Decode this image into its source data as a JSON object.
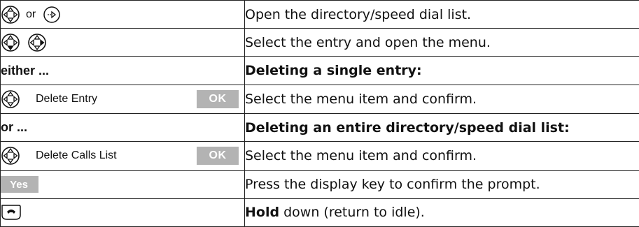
{
  "rows": [
    {
      "type": "step",
      "left": {
        "icons": [
          "control-key-icon",
          "menu-key-icon"
        ],
        "separator": "or"
      },
      "right": "Open the directory/speed dial list."
    },
    {
      "type": "step",
      "left": {
        "icons": [
          "control-key-down-icon",
          "control-key-right-icon"
        ]
      },
      "right": "Select the entry and open the menu."
    },
    {
      "type": "heading",
      "left": "either ...",
      "right": "Deleting a single entry:"
    },
    {
      "type": "step",
      "left": {
        "icons": [
          "control-key-icon"
        ],
        "menu_item": "Delete Entry",
        "key": "OK"
      },
      "right": "Select the menu item and confirm."
    },
    {
      "type": "heading",
      "left": "or ...",
      "right": "Deleting an entire directory/speed dial list:"
    },
    {
      "type": "step",
      "left": {
        "icons": [
          "control-key-icon"
        ],
        "menu_item": "Delete Calls List",
        "key": "OK"
      },
      "right": "Select the menu item and confirm."
    },
    {
      "type": "step",
      "left": {
        "key": "Yes"
      },
      "right": "Press the display key to confirm the prompt."
    },
    {
      "type": "step",
      "left": {
        "icons": [
          "end-call-key-icon"
        ]
      },
      "right_bold": "Hold",
      "right": " down (return to idle)."
    }
  ],
  "colors": {
    "softkey_background": "#b3b3b3",
    "softkey_text": "#ffffff",
    "border": "#222222"
  }
}
